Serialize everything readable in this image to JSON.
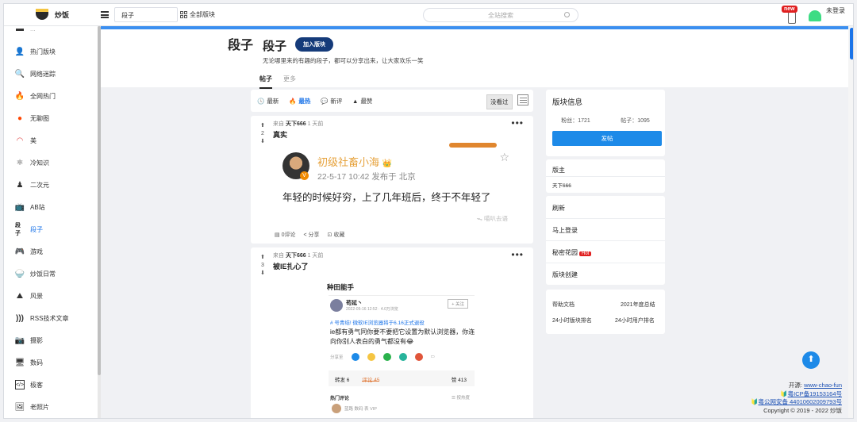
{
  "topbar": {
    "logo_text": "炒饭",
    "board_select": "段子",
    "all_boards": "全部版块",
    "search_placeholder": "全站搜索",
    "new_badge": "new",
    "login": "未登录"
  },
  "sidebar": {
    "items": [
      {
        "label": "热门版块",
        "icon": "user-icon"
      },
      {
        "label": "网络迷踪",
        "icon": "magnifier-icon"
      },
      {
        "label": "全网热门",
        "icon": "fire-icon"
      },
      {
        "label": "无聊图",
        "icon": "reddit-icon"
      },
      {
        "label": "美",
        "icon": "lips-icon"
      },
      {
        "label": "冷知识",
        "icon": "atom-icon"
      },
      {
        "label": "二次元",
        "icon": "figure-icon"
      },
      {
        "label": "AB站",
        "icon": "tv-icon"
      },
      {
        "label": "段子",
        "icon": "duanzi-icon",
        "active": true
      },
      {
        "label": "游戏",
        "icon": "gamepad-icon"
      },
      {
        "label": "炒饭日常",
        "icon": "bowl-icon"
      },
      {
        "label": "风景",
        "icon": "landscape-icon"
      },
      {
        "label": "RSS技术文章",
        "icon": "rss-icon"
      },
      {
        "label": "摄影",
        "icon": "camera-icon"
      },
      {
        "label": "数码",
        "icon": "monitor-icon"
      },
      {
        "label": "极客",
        "icon": "code-icon"
      },
      {
        "label": "老照片",
        "icon": "photo-icon"
      }
    ]
  },
  "board": {
    "logo": "段子",
    "title": "段子",
    "join_label": "加入版块",
    "description": "无论哪里来的有趣的段子，都可以分享出来，让大家欢乐一笑",
    "tabs": [
      "帖子",
      "更多"
    ]
  },
  "sortbar": {
    "items": [
      "最新",
      "最热",
      "新评",
      "最赞"
    ],
    "active": "最热",
    "seen_label": "没看过"
  },
  "posts": [
    {
      "score": "2",
      "from_label": "来自",
      "author": "天下666",
      "time": "1 天前",
      "title": "真实",
      "image": {
        "username": "初级社畜小海",
        "date": "22-5-17 10:42  发布于 北京",
        "quote": "年轻的时候好穷，上了几年班后，终于不年轻了",
        "watermark": "ᯓ 喵叭去语"
      },
      "comments": "0评论",
      "share": "分享",
      "fav": "收藏"
    },
    {
      "score": "3",
      "from_label": "来自",
      "author": "天下666",
      "time": "1 天前",
      "title": "被IE扎心了",
      "image": {
        "heading": "种田能手",
        "poster": "苟延丶",
        "poster_meta": "2022-05-16 12:52 · 4.0万浏览",
        "follow": "+ 关注",
        "link": "# 号青结! 微软IE浏览器将于6.16正式退役",
        "text": "ie都有勇气同你要不要把它设置为默认浏览器，你连向你别人表白的勇气都没有😂",
        "share_label": "分享至",
        "tab_forward": "转发 6",
        "tab_comment": "评论 45",
        "tab_like": "赞 413",
        "hot_comments": "热门评论",
        "sort_label": "☰ 按热度",
        "commenter": "蓝路 数码 表 VIP"
      }
    }
  ],
  "right": {
    "board_info_title": "版块信息",
    "fans": "粉丝：1721",
    "posts": "帖子：1095",
    "post_btn": "发帖",
    "moderator_title": "版主",
    "moderator": "天下666",
    "links": [
      "刷新",
      "马上登录",
      "秘密花园",
      "版块创建"
    ],
    "hot_tag": "Hot",
    "help": [
      "帮助文档",
      "2021年度总结",
      "24小时版块排名",
      "24小时用户排名"
    ]
  },
  "footer": {
    "open_label": "开源:",
    "open_link": "www-chao-fun",
    "icp": "粤ICP备19153164号",
    "police": "粤公网安备 44010602009793号",
    "copyright": "Copyright © 2019 - 2022 炒饭"
  },
  "colors": {
    "accent": "#1d8ae8",
    "join": "#153b7a",
    "hot": "#e02020",
    "username": "#e6a13a"
  }
}
